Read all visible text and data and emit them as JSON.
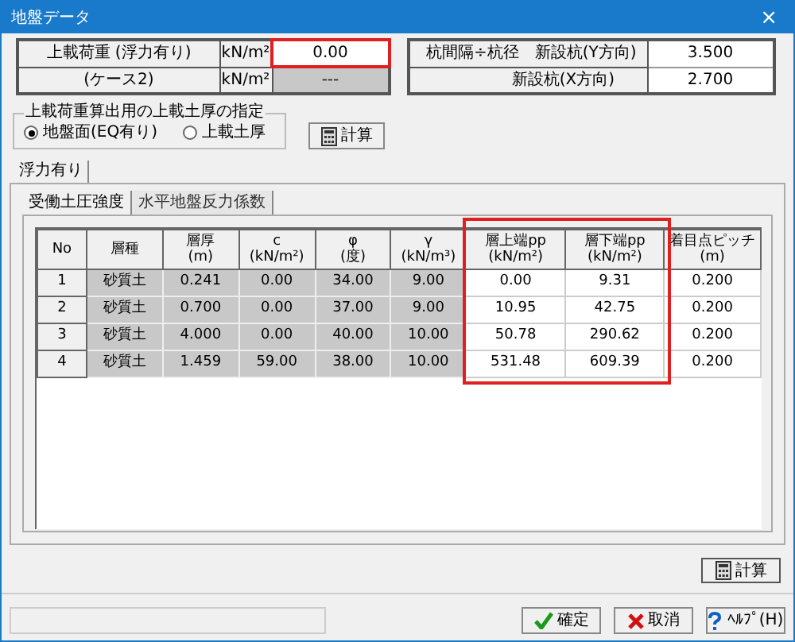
{
  "window": {
    "title": "地盤データ",
    "close": "×"
  },
  "load_table": [
    {
      "label": "上載荷重 (浮力有り)",
      "unit": "kN/m²",
      "value": "0.00",
      "disabled": false,
      "highlighted": true
    },
    {
      "label": "(ケース2)",
      "unit": "kN/m²",
      "value": "---",
      "disabled": true,
      "highlighted": false
    }
  ],
  "spacing_table": [
    {
      "label": "杭間隔÷杭径　新設杭(Y方向)",
      "value": "3.500"
    },
    {
      "label": "新設杭(X方向)",
      "value": "2.700"
    }
  ],
  "soil_thickness_group": {
    "legend": "上載荷重算出用の上載土厚の指定",
    "options": [
      {
        "label": "地盤面(EQ有り)",
        "selected": true
      },
      {
        "label": "上載土厚",
        "selected": false
      }
    ]
  },
  "calc_button_top": "計算",
  "outer_tabs": [
    {
      "label": "浮力有り",
      "selected": true
    }
  ],
  "inner_tabs": [
    {
      "label": "受働土圧強度",
      "selected": true
    },
    {
      "label": "水平地盤反力係数",
      "selected": false
    }
  ],
  "table": {
    "columns": [
      {
        "label": "No",
        "shaded": false
      },
      {
        "label": "層種",
        "shaded": true
      },
      {
        "label": "層厚\n(m)",
        "shaded": true
      },
      {
        "label": "c\n(kN/m²)",
        "shaded": true
      },
      {
        "label": "φ\n(度)",
        "shaded": true
      },
      {
        "label": "γ\n(kN/m³)",
        "shaded": true
      },
      {
        "label": "層上端pp\n(kN/m²)",
        "shaded": false
      },
      {
        "label": "層下端pp\n(kN/m²)",
        "shaded": false
      },
      {
        "label": "着目点ピッチ\n(m)",
        "shaded": false
      }
    ],
    "rows": [
      [
        "1",
        "砂質土",
        "0.241",
        "0.00",
        "34.00",
        "9.00",
        "0.00",
        "9.31",
        "0.200"
      ],
      [
        "2",
        "砂質土",
        "0.700",
        "0.00",
        "37.00",
        "9.00",
        "10.95",
        "42.75",
        "0.200"
      ],
      [
        "3",
        "砂質土",
        "4.000",
        "0.00",
        "40.00",
        "10.00",
        "50.78",
        "290.62",
        "0.200"
      ],
      [
        "4",
        "砂質土",
        "1.459",
        "59.00",
        "38.00",
        "10.00",
        "531.48",
        "609.39",
        "0.200"
      ]
    ]
  },
  "calc_button_bottom": "計算",
  "buttons": [
    {
      "kind": "ok",
      "label": "確定"
    },
    {
      "kind": "cancel",
      "label": "取消"
    },
    {
      "kind": "help",
      "label": "ﾍﾙﾌﾟ(H)"
    }
  ]
}
